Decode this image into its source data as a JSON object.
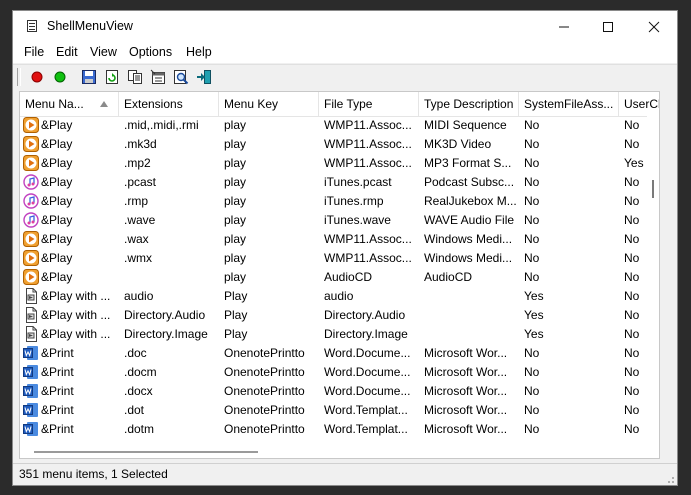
{
  "window": {
    "title": "ShellMenuView"
  },
  "menu": [
    "File",
    "Edit",
    "View",
    "Options",
    "Help"
  ],
  "toolbar": {
    "buttons": [
      "red-dot-icon",
      "green-dot-icon",
      "save-icon",
      "refresh-icon",
      "copy-icon",
      "properties-icon",
      "find-icon",
      "exit-icon"
    ]
  },
  "columns": [
    "Menu Na...",
    "Extensions",
    "Menu Key",
    "File Type",
    "Type Description",
    "SystemFileAss...",
    "UserCh"
  ],
  "rows": [
    {
      "icon": "play",
      "cells": [
        "&Play",
        ".mid,.midi,.rmi",
        "play",
        "WMP11.Assoc...",
        "MIDI Sequence",
        "No",
        "No"
      ]
    },
    {
      "icon": "play",
      "cells": [
        "&Play",
        ".mk3d",
        "play",
        "WMP11.Assoc...",
        "MK3D Video",
        "No",
        "No"
      ]
    },
    {
      "icon": "play",
      "cells": [
        "&Play",
        ".mp2",
        "play",
        "WMP11.Assoc...",
        "MP3 Format S...",
        "No",
        "Yes"
      ]
    },
    {
      "icon": "itunes",
      "cells": [
        "&Play",
        ".pcast",
        "play",
        "iTunes.pcast",
        "Podcast Subsc...",
        "No",
        "No"
      ]
    },
    {
      "icon": "itunes",
      "cells": [
        "&Play",
        ".rmp",
        "play",
        "iTunes.rmp",
        "RealJukebox M...",
        "No",
        "No"
      ]
    },
    {
      "icon": "itunes",
      "cells": [
        "&Play",
        ".wave",
        "play",
        "iTunes.wave",
        "WAVE Audio File",
        "No",
        "No"
      ]
    },
    {
      "icon": "play",
      "cells": [
        "&Play",
        ".wax",
        "play",
        "WMP11.Assoc...",
        "Windows Medi...",
        "No",
        "No"
      ]
    },
    {
      "icon": "play",
      "cells": [
        "&Play",
        ".wmx",
        "play",
        "WMP11.Assoc...",
        "Windows Medi...",
        "No",
        "No"
      ]
    },
    {
      "icon": "play",
      "cells": [
        "&Play",
        "",
        "play",
        "AudioCD",
        "AudioCD",
        "No",
        "No"
      ]
    },
    {
      "icon": "doc",
      "cells": [
        "&Play with ...",
        "audio",
        "Play",
        "audio",
        "",
        "Yes",
        "No"
      ]
    },
    {
      "icon": "doc",
      "cells": [
        "&Play with ...",
        "Directory.Audio",
        "Play",
        "Directory.Audio",
        "",
        "Yes",
        "No"
      ]
    },
    {
      "icon": "doc",
      "cells": [
        "&Play with ...",
        "Directory.Image",
        "Play",
        "Directory.Image",
        "",
        "Yes",
        "No"
      ]
    },
    {
      "icon": "word",
      "cells": [
        "&Print",
        ".doc",
        "OnenotePrintto",
        "Word.Docume...",
        "Microsoft Wor...",
        "No",
        "No"
      ]
    },
    {
      "icon": "word",
      "cells": [
        "&Print",
        ".docm",
        "OnenotePrintto",
        "Word.Docume...",
        "Microsoft Wor...",
        "No",
        "No"
      ]
    },
    {
      "icon": "word",
      "cells": [
        "&Print",
        ".docx",
        "OnenotePrintto",
        "Word.Docume...",
        "Microsoft Wor...",
        "No",
        "No"
      ]
    },
    {
      "icon": "word",
      "cells": [
        "&Print",
        ".dot",
        "OnenotePrintto",
        "Word.Templat...",
        "Microsoft Wor...",
        "No",
        "No"
      ]
    },
    {
      "icon": "word",
      "cells": [
        "&Print",
        ".dotm",
        "OnenotePrintto",
        "Word.Templat...",
        "Microsoft Wor...",
        "No",
        "No"
      ]
    }
  ],
  "status": "351 menu items, 1 Selected"
}
